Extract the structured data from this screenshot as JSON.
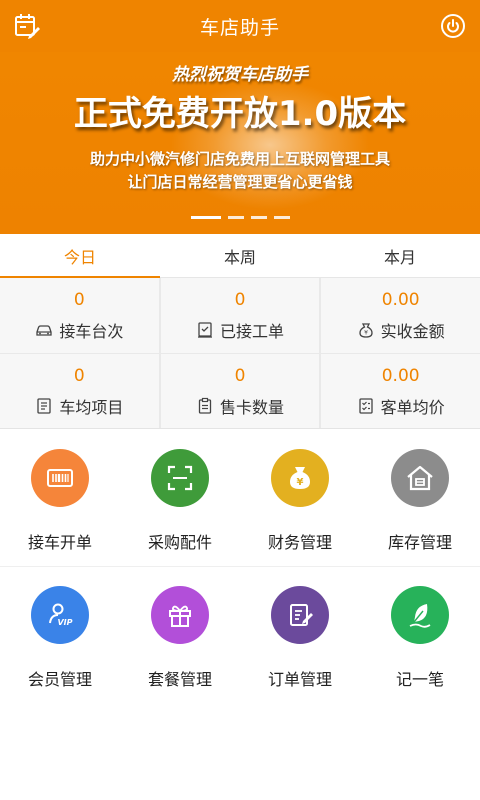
{
  "header": {
    "title": "车店助手",
    "left_icon": "edit-calendar-icon",
    "right_icon": "power-icon",
    "bg_color": "#ef8400"
  },
  "banner": {
    "line1": "热烈祝贺车店助手",
    "line2": "正式免费开放1.0版本",
    "line3": "助力中小微汽修门店免费用上互联网管理工具",
    "line4": "让门店日常经营管理更省心更省钱",
    "slide_count": 4,
    "active_slide": 1
  },
  "tabs": [
    {
      "label": "今日",
      "active": true
    },
    {
      "label": "本周",
      "active": false
    },
    {
      "label": "本月",
      "active": false
    }
  ],
  "stats": [
    {
      "value": "0",
      "label": "接车台次",
      "icon": "car-icon"
    },
    {
      "value": "0",
      "label": "已接工单",
      "icon": "work-order-icon"
    },
    {
      "value": "0.00",
      "label": "实收金额",
      "icon": "money-bag-icon"
    },
    {
      "value": "0",
      "label": "车均项目",
      "icon": "project-list-icon"
    },
    {
      "value": "0",
      "label": "售卡数量",
      "icon": "clipboard-icon"
    },
    {
      "value": "0.00",
      "label": "客单均价",
      "icon": "checklist-icon"
    }
  ],
  "functions": [
    {
      "label": "接车开单",
      "icon": "barcode-card-icon",
      "color": "#f5853a"
    },
    {
      "label": "采购配件",
      "icon": "scan-frame-icon",
      "color": "#3f9b3a"
    },
    {
      "label": "财务管理",
      "icon": "money-bag-icon",
      "color": "#e3b020"
    },
    {
      "label": "库存管理",
      "icon": "warehouse-icon",
      "color": "#8c8c8c"
    },
    {
      "label": "会员管理",
      "icon": "vip-member-icon",
      "color": "#3a83e8"
    },
    {
      "label": "套餐管理",
      "icon": "gift-icon",
      "color": "#b24fd9"
    },
    {
      "label": "订单管理",
      "icon": "order-edit-icon",
      "color": "#6b4a9c"
    },
    {
      "label": "记一笔",
      "icon": "feather-pen-icon",
      "color": "#27b25a"
    }
  ],
  "colors": {
    "accent": "#ef8400",
    "stat_bg": "#f7f7f7"
  }
}
